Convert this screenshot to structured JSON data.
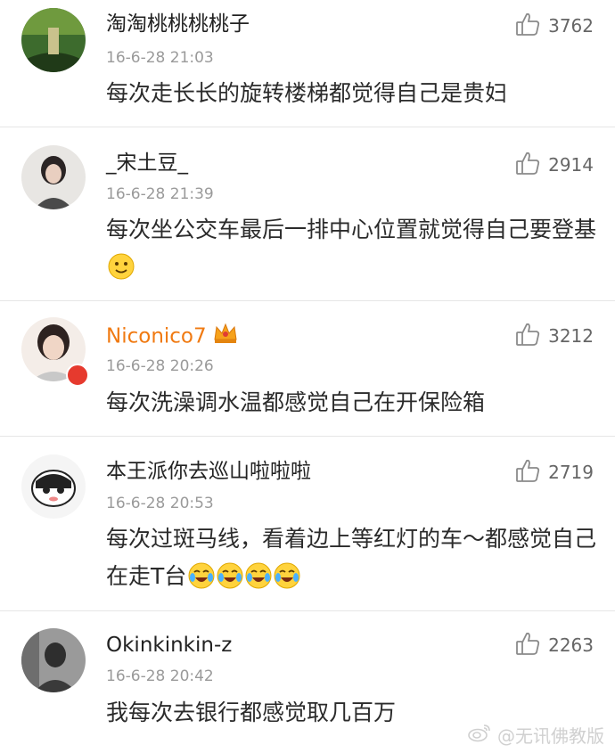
{
  "comments": [
    {
      "username": "淘淘桃桃桃桃子",
      "time": "16-6-28 21:03",
      "likes": "3762",
      "text": "每次走长长的旋转楼梯都觉得自己是贵妇"
    },
    {
      "username": "_宋土豆_",
      "time": "16-6-28 21:39",
      "likes": "2914",
      "text": "每次坐公交车最后一排中心位置就觉得自己要登基",
      "emoji": "smile-emoji"
    },
    {
      "username": "Niconico7",
      "time": "16-6-28 20:26",
      "likes": "3212",
      "text": "每次洗澡调水温都感觉自己在开保险箱",
      "badge": "crown-icon"
    },
    {
      "username": "本王派你去巡山啦啦啦",
      "time": "16-6-28 20:53",
      "likes": "2719",
      "text": "每次过斑马线，看着边上等红灯的车～都感觉自己在走T台",
      "emoji": "laugh-cry-emoji"
    },
    {
      "username": "Okinkinkin-z",
      "time": "16-6-28 20:42",
      "likes": "2263",
      "text": "我每次去银行都感觉取几百万"
    }
  ],
  "watermark": {
    "text": "@无讯佛教版"
  },
  "colors": {
    "vip_name": "#f07a12",
    "time": "#9a9a9a",
    "divider": "#e6e6e6"
  }
}
